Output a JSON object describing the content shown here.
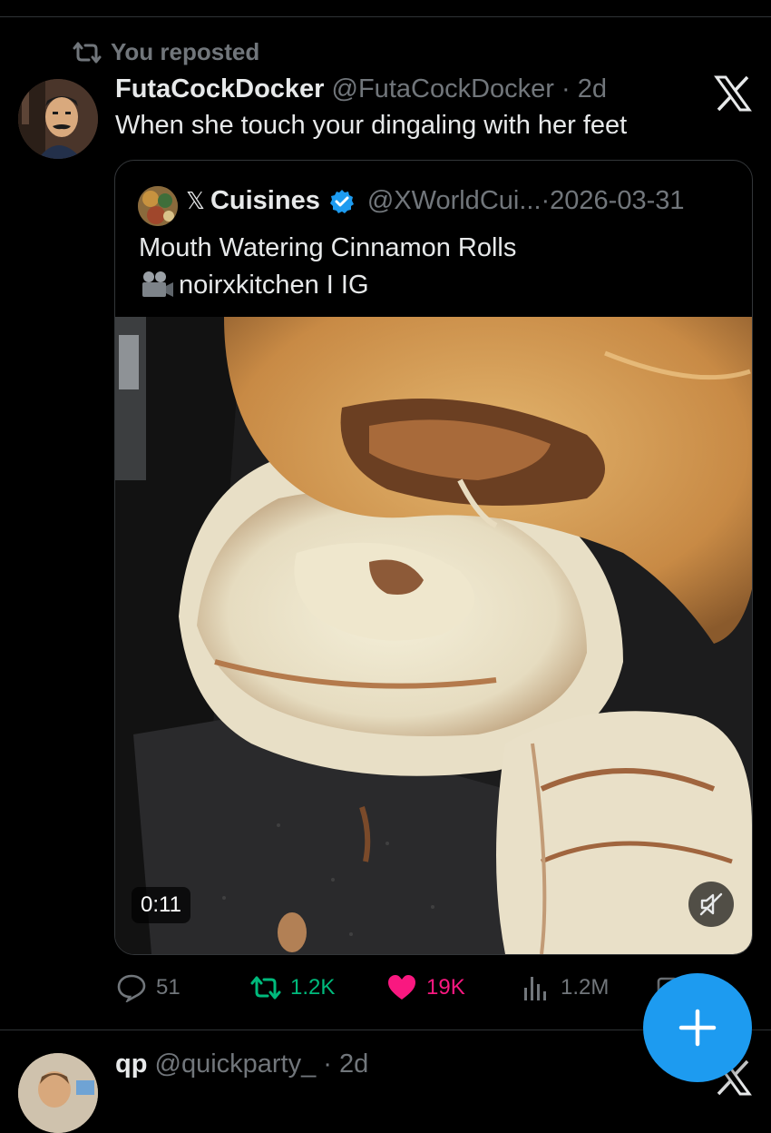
{
  "repost_banner": {
    "label": "You reposted",
    "icon": "repost-icon"
  },
  "post": {
    "display_name": "FutaCockDocker",
    "handle": "@FutaCockDocker",
    "time": "2d",
    "text": "When she touch your dingaling with her feet",
    "brand_icon": "x-logo-icon"
  },
  "quote": {
    "display_name": "Cuisines",
    "name_prefix": "𝕏",
    "verified": true,
    "handle": "@XWorldCui...",
    "time": "2026-03-31",
    "text_line1": "Mouth Watering Cinnamon Rolls",
    "text_line2": "noirxkitchen I IG",
    "video_duration": "0:11",
    "muted": true
  },
  "actions": {
    "replies": "51",
    "reposts": "1.2K",
    "likes": "19K",
    "views": "1.2M"
  },
  "next_post": {
    "display_name": "qp",
    "handle": "@quickparty_",
    "time": "2d"
  },
  "fab": {
    "icon": "plus-icon"
  },
  "colors": {
    "background": "#000000",
    "text": "#e7e9ea",
    "muted_text": "#71767b",
    "repost_green": "#00ba7c",
    "like_pink": "#f91880",
    "accent_blue": "#1d9bf0"
  }
}
